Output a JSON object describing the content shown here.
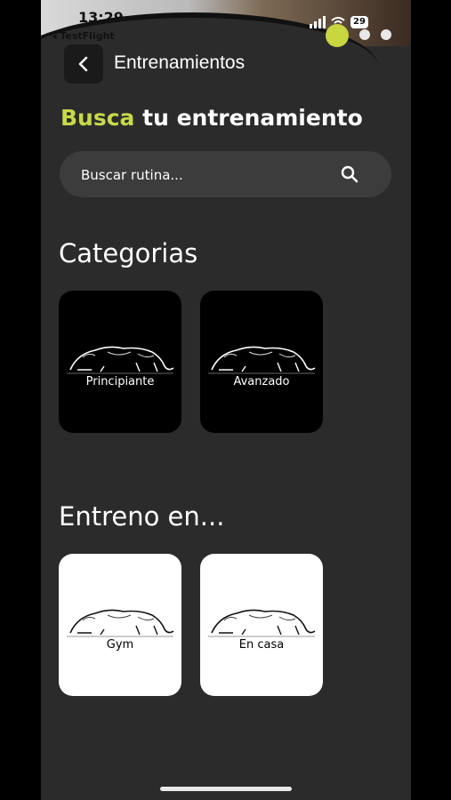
{
  "status_bar": {
    "time": "13:29",
    "back_app": "◂ TestFlight",
    "battery": "29"
  },
  "header": {
    "title": "Entrenamientos"
  },
  "headline": {
    "accent": "Busca",
    "rest": " tu entrenamiento"
  },
  "search": {
    "placeholder": "Buscar rutina..."
  },
  "categories": {
    "title": "Categorias",
    "items": [
      {
        "label": "Principiante"
      },
      {
        "label": "Avanzado"
      }
    ]
  },
  "places": {
    "title": "Entreno en...",
    "items": [
      {
        "label": "Gym"
      },
      {
        "label": "En casa"
      }
    ]
  },
  "colors": {
    "accent": "#c7d94a",
    "background": "#2b2b2c",
    "search_bg": "#3c3c3d"
  },
  "icons": [
    "chevron-left-icon",
    "search-icon",
    "panther-icon"
  ]
}
